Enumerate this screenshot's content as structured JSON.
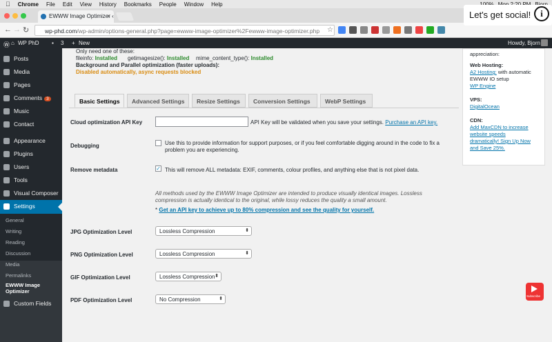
{
  "mac_menu": {
    "items": [
      "Chrome",
      "File",
      "Edit",
      "View",
      "History",
      "Bookmarks",
      "People",
      "Window",
      "Help"
    ],
    "time": "Mon 2:20 PM",
    "battery": "100%",
    "user": "Bjorn"
  },
  "browser": {
    "tab_title": "EWWW Image Optimizer ‹ WP",
    "url_host": "wp-phd.com",
    "url_path": "/wp-admin/options-general.php?page=ewww-image-optimizer%2Fewww-image-optimizer.php"
  },
  "overlay": {
    "social_text": "Let's get social!",
    "info_glyph": "i",
    "subscribe": "Subscribe"
  },
  "adminbar": {
    "site": "WP PhD",
    "comments_count": "3",
    "new_label": "New",
    "howdy": "Howdy, Bjorn"
  },
  "sidebar": {
    "items": [
      {
        "label": "Posts",
        "icon": "pin-icon"
      },
      {
        "label": "Media",
        "icon": "media-icon"
      },
      {
        "label": "Pages",
        "icon": "pages-icon"
      },
      {
        "label": "Comments",
        "icon": "comments-icon",
        "badge": "3"
      },
      {
        "label": "Music",
        "icon": "music-icon"
      },
      {
        "label": "Contact",
        "icon": "mail-icon"
      },
      {
        "label": "Appearance",
        "icon": "brush-icon"
      },
      {
        "label": "Plugins",
        "icon": "plugin-icon"
      },
      {
        "label": "Users",
        "icon": "users-icon"
      },
      {
        "label": "Tools",
        "icon": "wrench-icon"
      },
      {
        "label": "Visual Composer",
        "icon": "vc-icon"
      },
      {
        "label": "Settings",
        "icon": "settings-icon"
      }
    ],
    "submenu": [
      "General",
      "Writing",
      "Reading",
      "Discussion",
      "Media",
      "Permalinks",
      "EWWW Image Optimizer"
    ],
    "custom_fields": "Custom Fields"
  },
  "status": {
    "need_one": "Only need one of these:",
    "fileinfo_label": "fileinfo:",
    "fileinfo_val": "Installed",
    "getimagesize_label": "getimagesize():",
    "getimagesize_val": "Installed",
    "mime_label": "mime_content_type():",
    "mime_val": "Installed",
    "bg_heading": "Background and Parallel optimization (faster uploads):",
    "bg_value": "Disabled automatically, async requests blocked"
  },
  "tabs": [
    "Basic Settings",
    "Advanced Settings",
    "Resize Settings",
    "Conversion Settings",
    "WebP Settings"
  ],
  "settings": {
    "api_label": "Cloud optimization API Key",
    "api_value": "",
    "api_note": "API Key will be validated when you save your settings.",
    "api_link": "Purchase an API key.",
    "debug_label": "Debugging",
    "debug_text_1": "Use this to provide information for support purposes, or if you feel comfortable digging around in the code to fix a",
    "debug_text_2": "problem you are experiencing.",
    "meta_label": "Remove metadata",
    "meta_text": "This will remove ALL metadata: EXIF, comments, colour profiles, and anything else that is not pixel data.",
    "info_1": "All methods used by the EWWW Image Optimizer are intended to produce visually identical images. Lossless",
    "info_2": "compression is actually identical to the original, while lossy reduces the quality a small amount.",
    "info_star": "*",
    "info_link": "Get an API key to achieve up to 80% compression and see the quality for yourself.",
    "jpg_label": "JPG Optimization Level",
    "jpg_value": "Lossless Compression",
    "png_label": "PNG Optimization Level",
    "png_value": "Lossless Compression",
    "gif_label": "GIF Optimization Level",
    "gif_value": "Lossless Compression",
    "pdf_label": "PDF Optimization Level",
    "pdf_value": "No Compression"
  },
  "sidebox": {
    "appreciation": "appreciation:",
    "web_hosting": "Web Hosting:",
    "a2_link": "A2 Hosting:",
    "a2_text_1": "with automatic",
    "a2_text_2": "EWWW IO setup",
    "wpengine": "WP Engine",
    "vps": "VPS:",
    "digitalocean": "DigitalOcean",
    "cdn": "CDN:",
    "cdn_1": "Add MaxCDN to increase",
    "cdn_2": "website speeds",
    "cdn_3": "dramatically! Sign Up Now",
    "cdn_4": "and Save 25%."
  }
}
